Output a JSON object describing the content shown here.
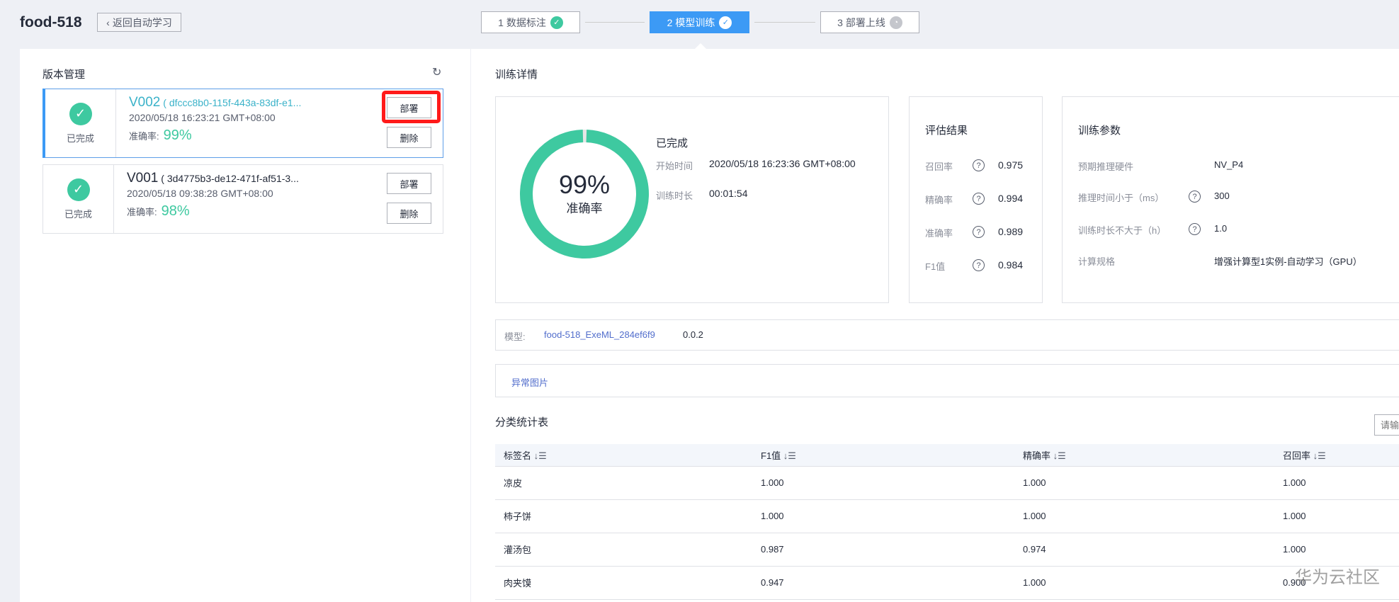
{
  "header": {
    "title": "food-518",
    "back": "返回自动学习"
  },
  "steps": [
    {
      "label": "1 数据标注",
      "status": "done"
    },
    {
      "label": "2 模型训练",
      "status": "active"
    },
    {
      "label": "3 部署上线",
      "status": "pending"
    }
  ],
  "versions": {
    "title": "版本管理",
    "items": [
      {
        "status": "已完成",
        "name": "V002",
        "id": "( dfccc8b0-115f-443a-83df-e1...",
        "date": "2020/05/18 16:23:21 GMT+08:00",
        "acc_label": "准确率:",
        "acc": "99%",
        "deploy": "部署",
        "delete": "删除"
      },
      {
        "status": "已完成",
        "name": "V001",
        "id": "( 3d4775b3-de12-471f-af51-3...",
        "date": "2020/05/18 09:38:28 GMT+08:00",
        "acc_label": "准确率:",
        "acc": "98%",
        "deploy": "部署",
        "delete": "删除"
      }
    ]
  },
  "detail": {
    "title": "训练详情",
    "percent": "99%",
    "percent_value": 99,
    "percent_label": "准确率",
    "status": "已完成",
    "start_label": "开始时间",
    "start": "2020/05/18 16:23:36 GMT+08:00",
    "dur_label": "训练时长",
    "dur": "00:01:54"
  },
  "eval": {
    "title": "评估结果",
    "rows": [
      {
        "k": "召回率",
        "v": "0.975"
      },
      {
        "k": "精确率",
        "v": "0.994"
      },
      {
        "k": "准确率",
        "v": "0.989"
      },
      {
        "k": "F1值",
        "v": "0.984"
      }
    ]
  },
  "params": {
    "title": "训练参数",
    "rows": [
      {
        "k": "预期推理硬件",
        "v": "NV_P4",
        "q": false
      },
      {
        "k": "推理时间小于（ms）",
        "v": "300",
        "q": true
      },
      {
        "k": "训练时长不大于（h）",
        "v": "1.0",
        "q": true
      },
      {
        "k": "计算规格",
        "v": "增强计算型1实例-自动学习（GPU）",
        "q": false
      }
    ]
  },
  "model": {
    "label": "模型:",
    "name": "food-518_ExeML_284ef6f9",
    "version": "0.0.2"
  },
  "abnormal": "异常图片",
  "table": {
    "title": "分类统计表",
    "search_placeholder": "请输",
    "headers": [
      "标签名",
      "F1值",
      "精确率",
      "召回率"
    ],
    "rows": [
      [
        "凉皮",
        "1.000",
        "1.000",
        "1.000"
      ],
      [
        "柿子饼",
        "1.000",
        "1.000",
        "1.000"
      ],
      [
        "灌汤包",
        "0.987",
        "0.974",
        "1.000"
      ],
      [
        "肉夹馍",
        "0.947",
        "1.000",
        "0.900"
      ]
    ]
  },
  "watermark": "华为云社区",
  "colors": {
    "accent": "#3c9af5",
    "success": "#3ec9a0",
    "highlight": "#ff1a1a"
  }
}
